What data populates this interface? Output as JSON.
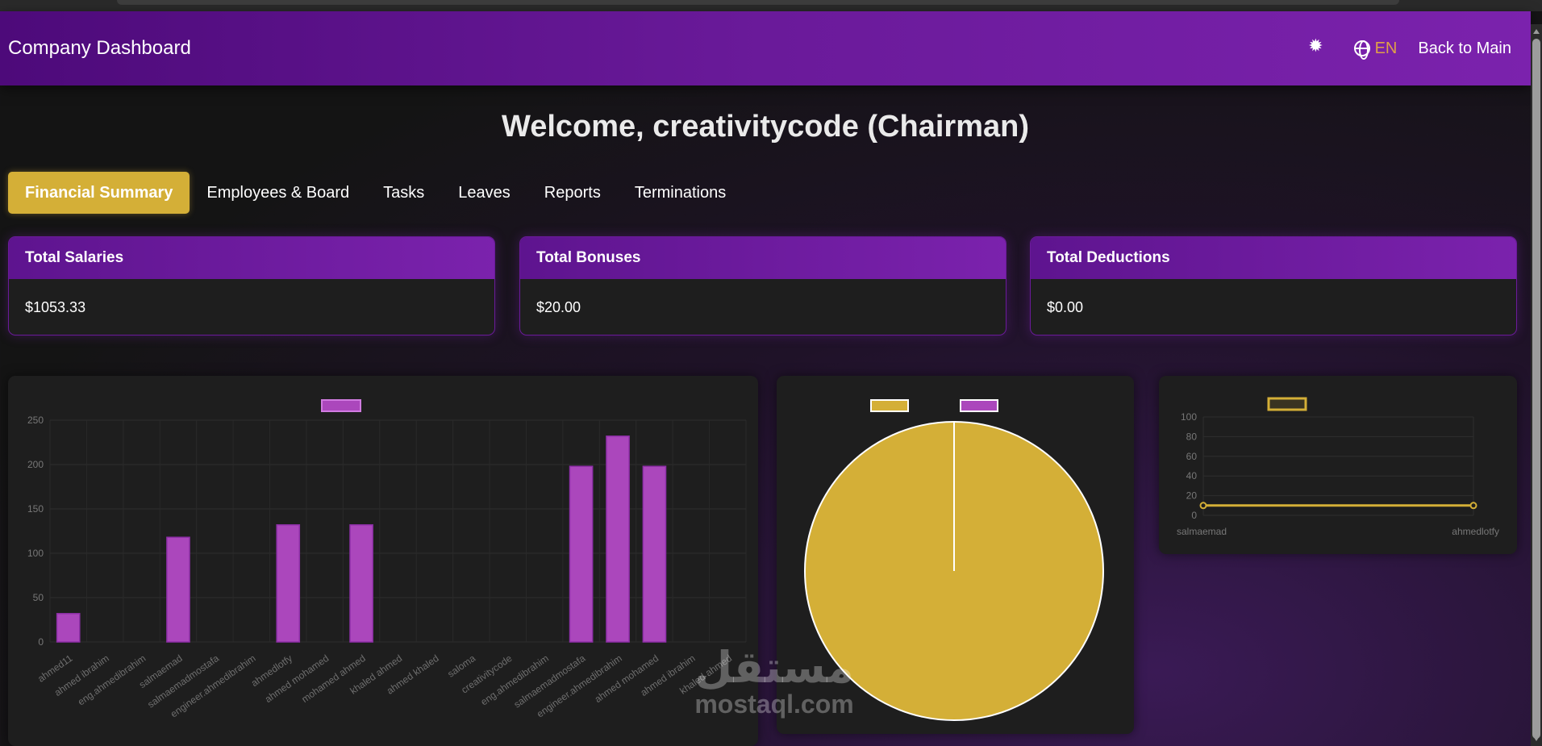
{
  "header": {
    "title": "Company Dashboard",
    "settings_icon": "gear-icon",
    "language_icon": "globe-icon",
    "language": "EN",
    "back_label": "Back to Main"
  },
  "welcome": "Welcome, creativitycode (Chairman)",
  "tabs": [
    {
      "label": "Financial Summary",
      "active": true
    },
    {
      "label": "Employees & Board",
      "active": false
    },
    {
      "label": "Tasks",
      "active": false
    },
    {
      "label": "Leaves",
      "active": false
    },
    {
      "label": "Reports",
      "active": false
    },
    {
      "label": "Terminations",
      "active": false
    }
  ],
  "cards": [
    {
      "title": "Total Salaries",
      "value": "$1053.33"
    },
    {
      "title": "Total Bonuses",
      "value": "$20.00"
    },
    {
      "title": "Total Deductions",
      "value": "$0.00"
    }
  ],
  "colors": {
    "purple": "#ab47bc",
    "gold": "#d4af37",
    "header_start": "#4d0a7a",
    "header_end": "#7b22ad"
  },
  "chart_data": [
    {
      "type": "bar",
      "categories": [
        "ahmed11",
        "ahmed ibrahim",
        "eng.ahmedibrahim",
        "salmaemad",
        "salmaemadmostafa",
        "engineer.ahmedibrahim",
        "ahmedlotfy",
        "ahmed mohamed",
        "mohamed ahmed",
        "khaled ahmed",
        "ahmed khaled",
        "saloma",
        "creativitycode",
        "eng.ahmedibrahim",
        "salmaemadmostafa",
        "engineer.ahmedibrahim",
        "ahmed mohamed",
        "ahmed ibrahim",
        "khaled ahmed"
      ],
      "values": [
        32,
        0,
        0,
        118,
        0,
        0,
        132,
        0,
        132,
        0,
        0,
        0,
        0,
        0,
        198,
        232,
        198,
        0,
        0
      ],
      "ylim": [
        0,
        250
      ],
      "yticks": [
        0,
        50,
        100,
        150,
        200,
        250
      ],
      "legend": "top",
      "color": "#ab47bc",
      "grid": true
    },
    {
      "type": "pie",
      "values": [
        100,
        0
      ],
      "colors": [
        "#d4af37",
        "#ab47bc"
      ],
      "legend": "top"
    },
    {
      "type": "line",
      "categories": [
        "salmaemad",
        "ahmedlotfy"
      ],
      "values": [
        10,
        10
      ],
      "ylim": [
        0,
        100
      ],
      "yticks": [
        0,
        20,
        40,
        60,
        80,
        100
      ],
      "legend": "top",
      "color": "#d4af37",
      "grid": true
    }
  ],
  "watermark": {
    "arabic": "مستقل",
    "latin": "mostaql.com"
  }
}
